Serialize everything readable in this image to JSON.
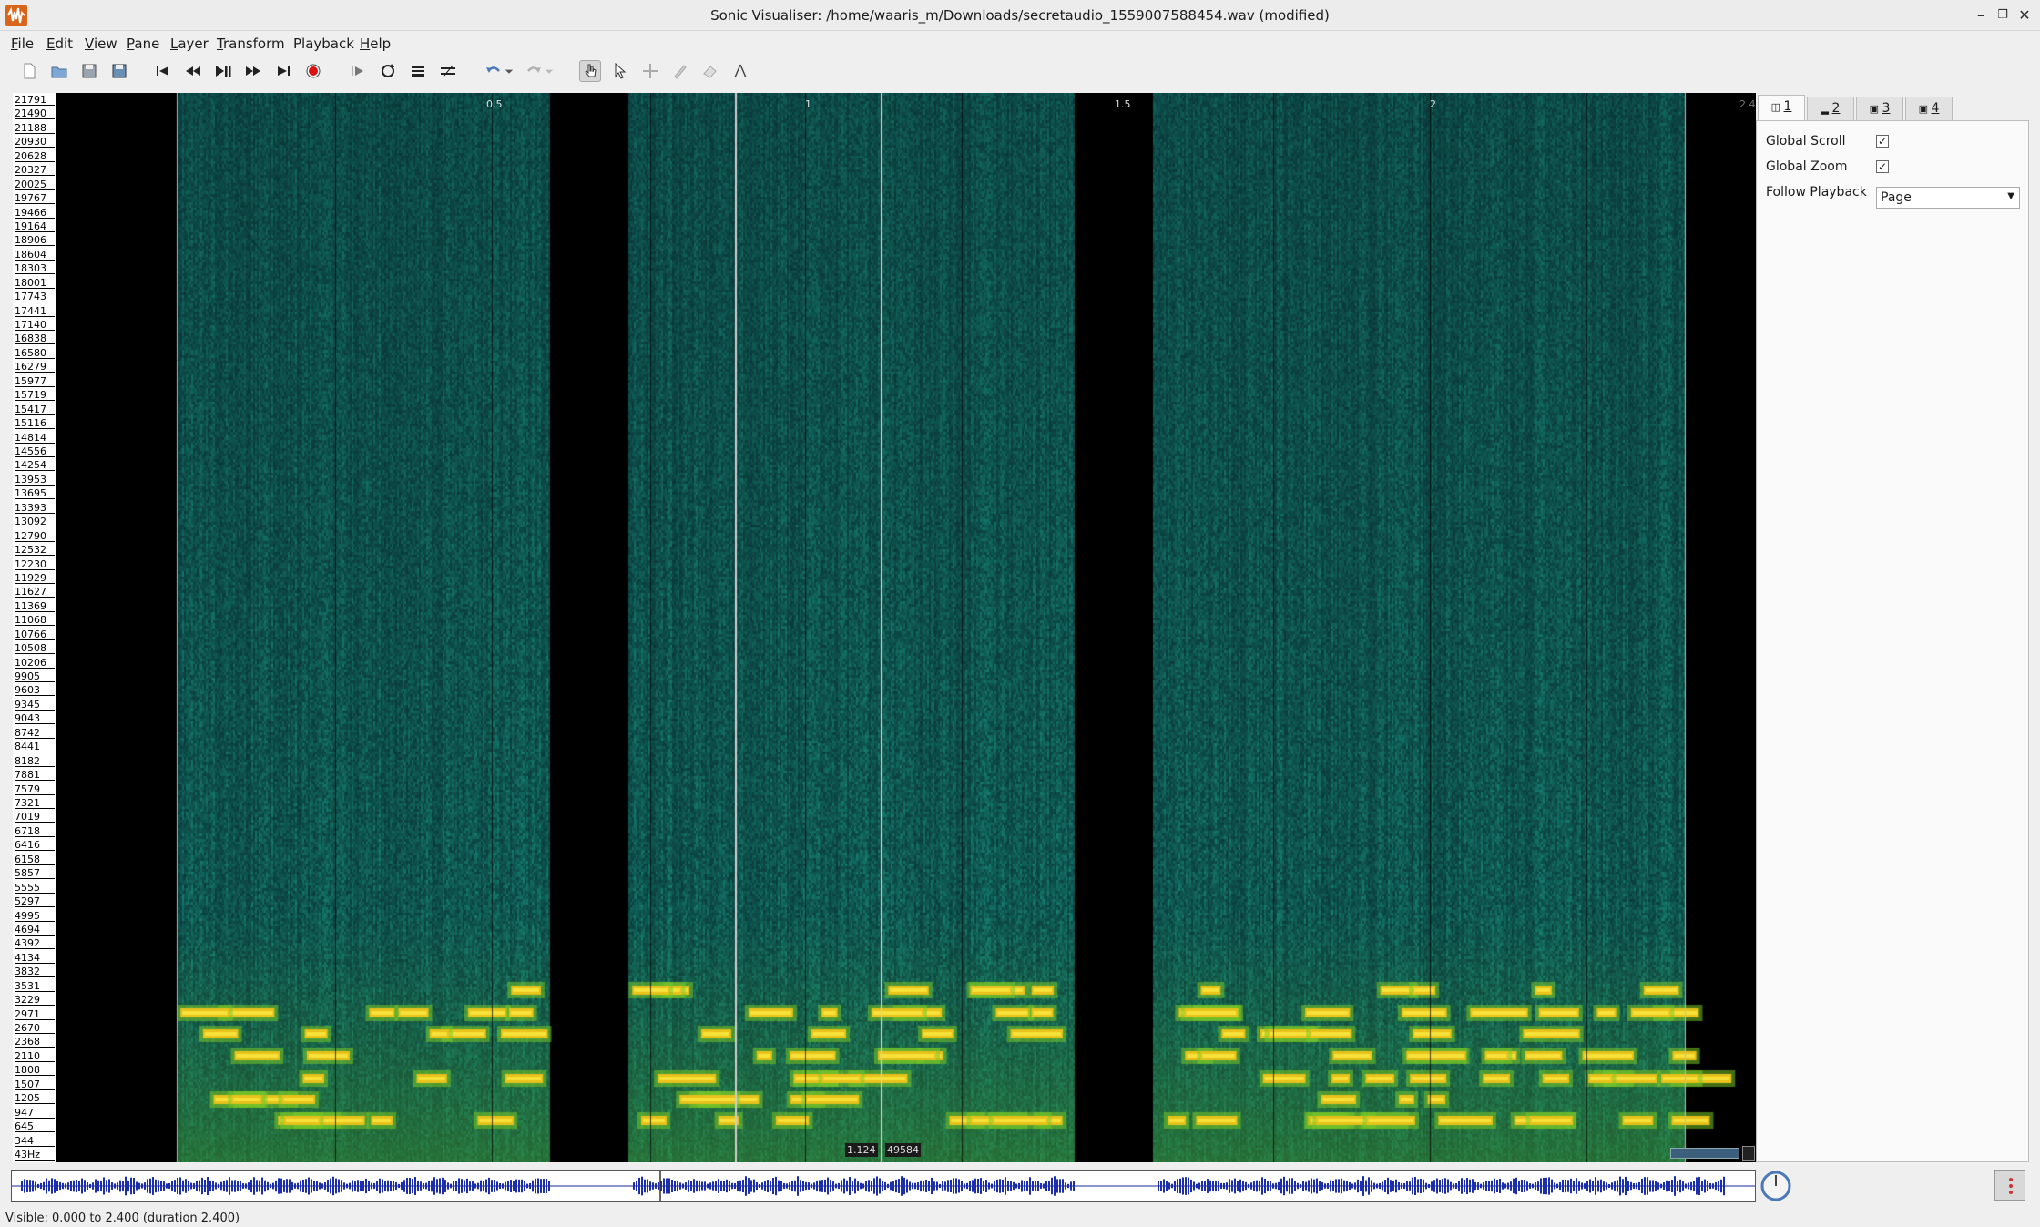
{
  "window": {
    "title": "Sonic Visualiser: /home/waaris_m/Downloads/secretaudio_1559007588454.wav (modified)"
  },
  "menu": {
    "items": [
      {
        "label": "File",
        "u": "F",
        "rest": "ile"
      },
      {
        "label": "Edit",
        "u": "E",
        "rest": "dit"
      },
      {
        "label": "View",
        "u": "V",
        "rest": "iew"
      },
      {
        "label": "Pane",
        "u": "P",
        "rest": "ane"
      },
      {
        "label": "Layer",
        "u": "L",
        "rest": "ayer"
      },
      {
        "label": "Transform",
        "u": "T",
        "rest": "ransform"
      },
      {
        "label": "Playback",
        "u": "",
        "rest": "Playback"
      },
      {
        "label": "Help",
        "u": "H",
        "rest": "elp"
      }
    ]
  },
  "spectrogram": {
    "frequency_ticks": [
      "21791",
      "21490",
      "21188",
      "20930",
      "20628",
      "20327",
      "20025",
      "19767",
      "19466",
      "19164",
      "18906",
      "18604",
      "18303",
      "18001",
      "17743",
      "17441",
      "17140",
      "16838",
      "16580",
      "16279",
      "15977",
      "15719",
      "15417",
      "15116",
      "14814",
      "14556",
      "14254",
      "13953",
      "13695",
      "13393",
      "13092",
      "12790",
      "12532",
      "12230",
      "11929",
      "11627",
      "11369",
      "11068",
      "10766",
      "10508",
      "10206",
      "9905",
      "9603",
      "9345",
      "9043",
      "8742",
      "8441",
      "8182",
      "7881",
      "7579",
      "7321",
      "7019",
      "6718",
      "6416",
      "6158",
      "5857",
      "5555",
      "5297",
      "4995",
      "4694",
      "4392",
      "4134",
      "3832",
      "3531",
      "3229",
      "2971",
      "2670",
      "2368",
      "2110",
      "1808",
      "1507",
      "1205",
      "947",
      "645",
      "344",
      "43Hz"
    ],
    "time_labels": [
      "0.5",
      "1",
      "1.5",
      "2",
      "2.4"
    ],
    "cursor_time": "1.124",
    "cursor_frame": "49584"
  },
  "properties": {
    "tabs": [
      "1",
      "2",
      "3",
      "4"
    ],
    "global_scroll_label": "Global Scroll",
    "global_scroll": true,
    "global_zoom_label": "Global Zoom",
    "global_zoom": true,
    "follow_playback_label": "Follow Playback",
    "follow_playback_value": "Page"
  },
  "status": {
    "text": "Visible: 0.000 to 2.400 (duration 2.400)"
  },
  "colors": {
    "accent": "#d9651b",
    "spectro_low": "#0d2a2e",
    "spectro_high": "#f2d21a"
  }
}
